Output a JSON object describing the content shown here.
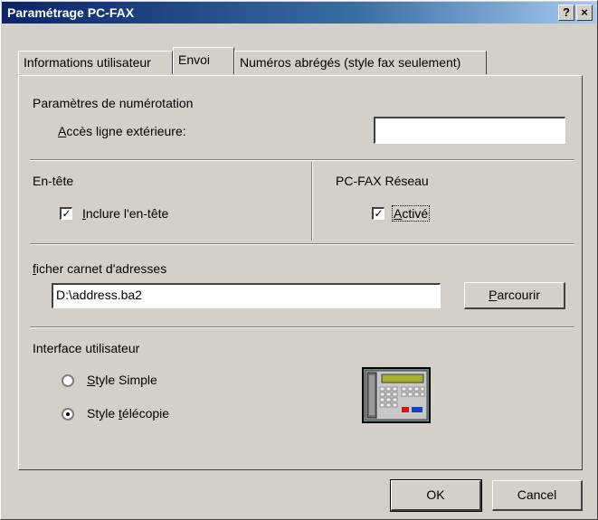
{
  "window": {
    "title": "Paramétrage PC-FAX",
    "help_button": "?",
    "close_button": "×"
  },
  "tabs": [
    {
      "label": "Informations utilisateur",
      "active": false
    },
    {
      "label": "Envoi",
      "active": true
    },
    {
      "label": "Numéros abrégés (style fax seulement)",
      "active": false
    }
  ],
  "dialing": {
    "section_label": "Paramètres de numérotation",
    "outside_line_label_access": "A",
    "outside_line_label_rest": "ccès ligne extérieure:",
    "outside_line_value": ""
  },
  "header_section": {
    "label": "En-tête",
    "include_checked": true,
    "include_label_mnemonic": "I",
    "include_label_rest": "nclure l'en-tête"
  },
  "network": {
    "label": "PC-FAX Réseau",
    "active_checked": true,
    "active_label_mnemonic": "A",
    "active_label_rest": "ctivé"
  },
  "addressbook": {
    "label_mnemonic": "f",
    "label_rest": "icher carnet d'adresses",
    "file_value": "D:\\address.ba2",
    "browse_mnemonic": "P",
    "browse_rest": "arcourir"
  },
  "ui_section": {
    "label": "Interface utilisateur",
    "simple_prefix": "",
    "simple_mnemonic": "S",
    "simple_rest": "tyle Simple",
    "fax_prefix": "Style ",
    "fax_mnemonic": "t",
    "fax_rest": "élécopie",
    "selected": "fax"
  },
  "footer": {
    "ok_label": "OK",
    "cancel_label": "Cancel"
  }
}
